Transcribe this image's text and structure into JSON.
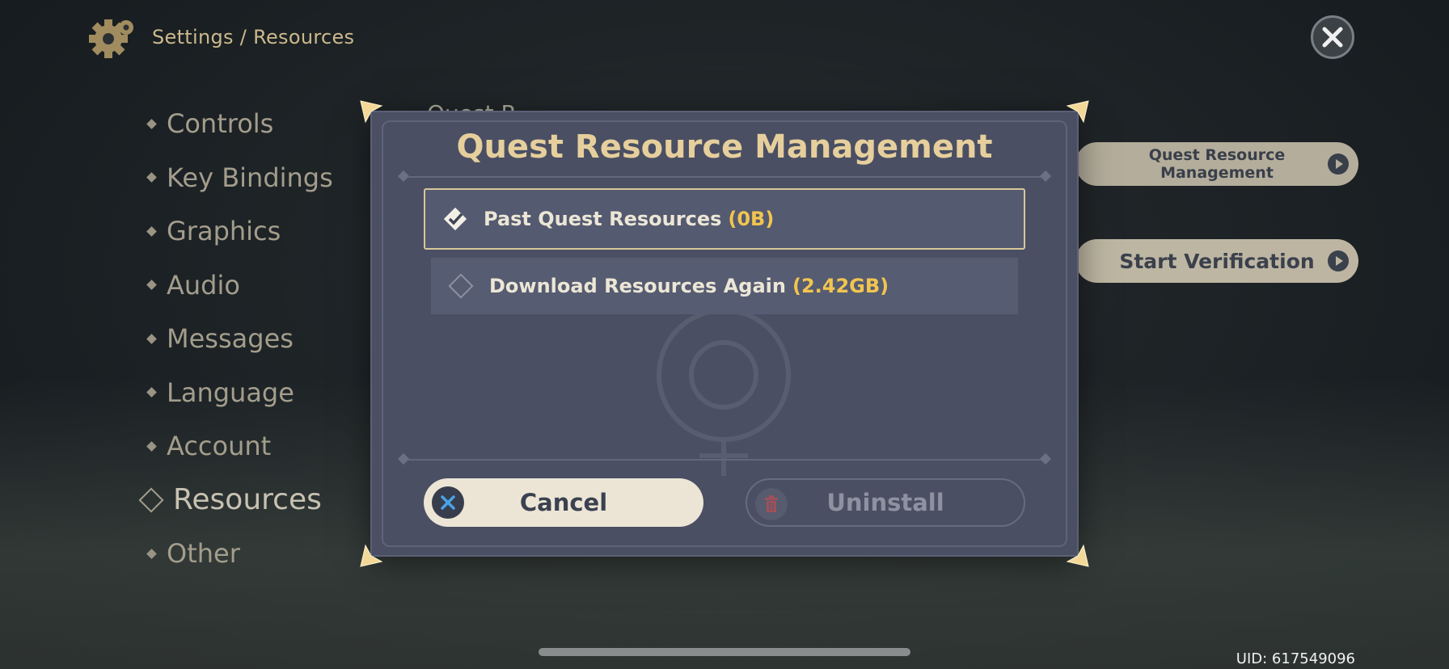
{
  "header": {
    "breadcrumb": "Settings / Resources",
    "gear_icon": "gear-icon",
    "close_icon": "close-icon"
  },
  "sidebar": {
    "items": [
      {
        "label": "Controls"
      },
      {
        "label": "Key Bindings"
      },
      {
        "label": "Graphics"
      },
      {
        "label": "Audio"
      },
      {
        "label": "Messages"
      },
      {
        "label": "Language"
      },
      {
        "label": "Account"
      },
      {
        "label": "Resources",
        "active": true
      },
      {
        "label": "Other"
      }
    ]
  },
  "background_panel": {
    "partial_title": "Quest R",
    "quest_resource_button": "Quest Resource\nManagement",
    "start_verification_button": "Start Verification"
  },
  "modal": {
    "title": "Quest Resource Management",
    "options": [
      {
        "label": "Past Quest Resources",
        "size": "(0B)",
        "checked": true
      },
      {
        "label": "Download Resources Again",
        "size": "(2.42GB)",
        "checked": false
      }
    ],
    "cancel_label": "Cancel",
    "uninstall_label": "Uninstall"
  },
  "footer": {
    "uid": "UID: 617549096"
  },
  "colors": {
    "accent_gold": "#e6cf9c",
    "size_highlight": "#f2c550",
    "modal_bg": "#4a4f63",
    "button_light": "#ece5d6"
  }
}
